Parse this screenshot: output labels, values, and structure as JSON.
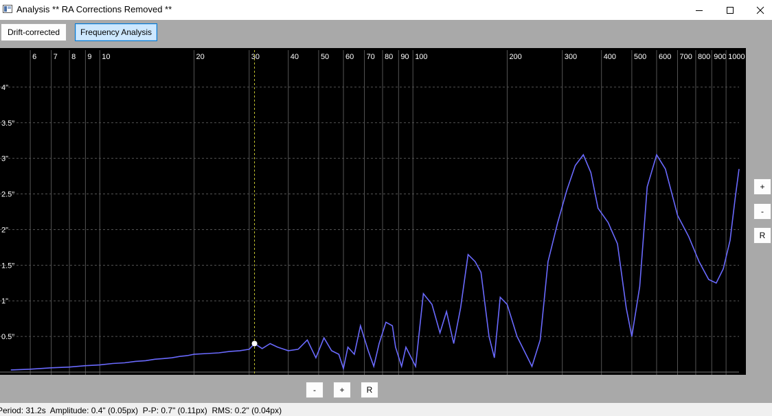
{
  "window": {
    "title": "Analysis ** RA Corrections Removed **",
    "minimize_glyph": "—",
    "maximize_glyph": "☐",
    "close_glyph": "✕"
  },
  "tabs": [
    {
      "label": "Drift-corrected",
      "active": false
    },
    {
      "label": "Frequency Analysis",
      "active": true
    }
  ],
  "vertical_controls": {
    "zoom_in": "+",
    "zoom_out": "-",
    "reset": "R"
  },
  "horizontal_controls": {
    "zoom_out": "-",
    "zoom_in": "+",
    "reset": "R"
  },
  "status": "Period: 31.2s  Amplitude: 0.4\" (0.05px)  P-P: 0.7\" (0.11px)  RMS: 0.2\" (0.04px)",
  "colors": {
    "curve": "#6a6aff",
    "background": "#000000",
    "gridline": "#555555",
    "cursor": "#c8c832",
    "marker": "#ffffff"
  },
  "chart_data": {
    "type": "line",
    "x_axis": {
      "scale": "log",
      "min": 5,
      "max": 1100,
      "tick_labels": [
        "6",
        "7",
        "8",
        "9",
        "10",
        "20",
        "30",
        "40",
        "50",
        "60",
        "70",
        "80",
        "90",
        "100",
        "200",
        "300",
        "400",
        "500",
        "600",
        "700",
        "800",
        "900",
        "1000"
      ]
    },
    "y_axis": {
      "min": 0,
      "max": 4.5,
      "unit": "\"",
      "tick_labels": [
        "0.5\"",
        "1\"",
        "1.5\"",
        "2\"",
        "2.5\"",
        "3\"",
        "3.5\"",
        "4\""
      ]
    },
    "grid": true,
    "cursor": {
      "x": 31.2,
      "y": 0.4
    },
    "series": [
      {
        "points": [
          [
            5.2,
            0.03
          ],
          [
            6,
            0.04
          ],
          [
            7,
            0.06
          ],
          [
            8,
            0.07
          ],
          [
            9,
            0.09
          ],
          [
            10,
            0.1
          ],
          [
            11,
            0.12
          ],
          [
            12,
            0.13
          ],
          [
            13,
            0.15
          ],
          [
            14,
            0.16
          ],
          [
            15,
            0.18
          ],
          [
            16,
            0.19
          ],
          [
            17,
            0.2
          ],
          [
            18,
            0.22
          ],
          [
            19,
            0.23
          ],
          [
            20,
            0.25
          ],
          [
            22,
            0.26
          ],
          [
            24,
            0.27
          ],
          [
            26,
            0.29
          ],
          [
            28,
            0.3
          ],
          [
            30,
            0.32
          ],
          [
            31.2,
            0.4
          ],
          [
            33,
            0.33
          ],
          [
            35,
            0.4
          ],
          [
            37,
            0.35
          ],
          [
            40,
            0.3
          ],
          [
            43,
            0.32
          ],
          [
            46,
            0.45
          ],
          [
            49,
            0.2
          ],
          [
            52,
            0.48
          ],
          [
            55,
            0.3
          ],
          [
            58,
            0.25
          ],
          [
            60,
            0.05
          ],
          [
            62,
            0.35
          ],
          [
            65,
            0.25
          ],
          [
            68,
            0.65
          ],
          [
            72,
            0.3
          ],
          [
            75,
            0.08
          ],
          [
            78,
            0.4
          ],
          [
            82,
            0.7
          ],
          [
            86,
            0.65
          ],
          [
            88,
            0.35
          ],
          [
            92,
            0.08
          ],
          [
            95,
            0.35
          ],
          [
            102,
            0.08
          ],
          [
            108,
            1.1
          ],
          [
            115,
            0.95
          ],
          [
            122,
            0.55
          ],
          [
            128,
            0.85
          ],
          [
            135,
            0.4
          ],
          [
            142,
            0.9
          ],
          [
            150,
            1.65
          ],
          [
            158,
            1.55
          ],
          [
            165,
            1.4
          ],
          [
            175,
            0.5
          ],
          [
            182,
            0.2
          ],
          [
            190,
            1.05
          ],
          [
            200,
            0.95
          ],
          [
            215,
            0.5
          ],
          [
            240,
            0.08
          ],
          [
            255,
            0.45
          ],
          [
            270,
            1.55
          ],
          [
            290,
            2.1
          ],
          [
            310,
            2.55
          ],
          [
            330,
            2.9
          ],
          [
            350,
            3.05
          ],
          [
            370,
            2.8
          ],
          [
            390,
            2.3
          ],
          [
            420,
            2.1
          ],
          [
            450,
            1.8
          ],
          [
            480,
            0.9
          ],
          [
            500,
            0.5
          ],
          [
            530,
            1.2
          ],
          [
            560,
            2.6
          ],
          [
            600,
            3.05
          ],
          [
            640,
            2.85
          ],
          [
            700,
            2.2
          ],
          [
            760,
            1.9
          ],
          [
            820,
            1.55
          ],
          [
            880,
            1.3
          ],
          [
            930,
            1.25
          ],
          [
            980,
            1.45
          ],
          [
            1030,
            1.85
          ],
          [
            1070,
            2.45
          ],
          [
            1100,
            2.85
          ]
        ]
      }
    ]
  }
}
